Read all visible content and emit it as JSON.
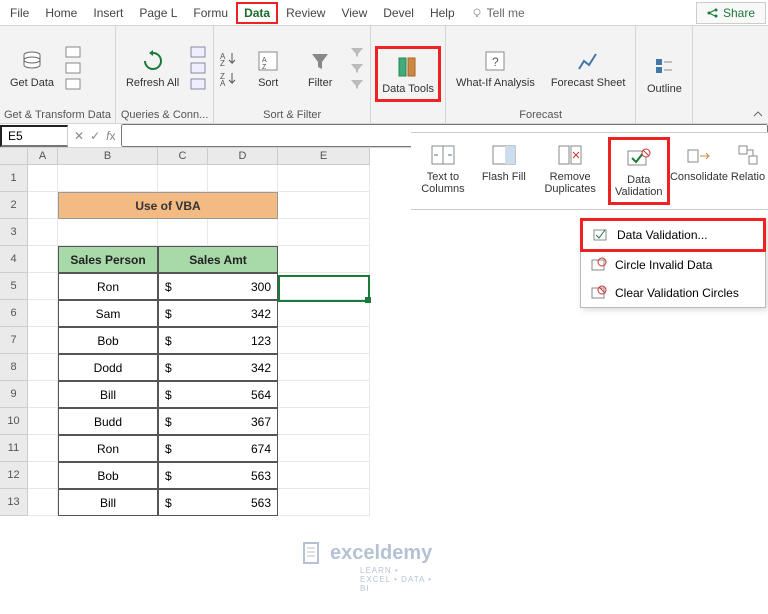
{
  "tabs": [
    "File",
    "Home",
    "Insert",
    "Page L",
    "Formu",
    "Data",
    "Review",
    "View",
    "Devel",
    "Help"
  ],
  "active_tab": "Data",
  "tell_me": "Tell me",
  "share": "Share",
  "ribbon": {
    "get_data": "Get Data",
    "refresh_all": "Refresh All",
    "sort": "Sort",
    "filter": "Filter",
    "data_tools": "Data Tools",
    "what_if": "What-If Analysis",
    "forecast_sheet": "Forecast Sheet",
    "outline": "Outline",
    "group_get": "Get & Transform Data",
    "group_queries": "Queries & Conn...",
    "group_sortfilter": "Sort & Filter",
    "group_forecast": "Forecast"
  },
  "flyout": {
    "text_to_columns": "Text to Columns",
    "flash_fill": "Flash Fill",
    "remove_duplicates": "Remove Duplicates",
    "data_validation": "Data Validation",
    "consolidate": "Consolidate",
    "relationships": "Relatio"
  },
  "dropdown": {
    "data_validation": "Data Validation...",
    "circle_invalid": "Circle Invalid Data",
    "clear_circles": "Clear Validation Circles"
  },
  "name_box": "E5",
  "columns": [
    "A",
    "B",
    "C",
    "D",
    "E"
  ],
  "sheet": {
    "title": "Use of VBA",
    "headers": [
      "Sales Person",
      "Sales Amt"
    ],
    "rows": [
      {
        "person": "Ron",
        "amt": 300
      },
      {
        "person": "Sam",
        "amt": 342
      },
      {
        "person": "Bob",
        "amt": 123
      },
      {
        "person": "Dodd",
        "amt": 342
      },
      {
        "person": "Bill",
        "amt": 564
      },
      {
        "person": "Budd",
        "amt": 367
      },
      {
        "person": "Ron",
        "amt": 674
      },
      {
        "person": "Bob",
        "amt": 563
      },
      {
        "person": "Bill",
        "amt": 563
      }
    ]
  },
  "watermark": {
    "brand": "exceldemy",
    "sub": "LEARN • EXCEL • DATA • BI"
  }
}
